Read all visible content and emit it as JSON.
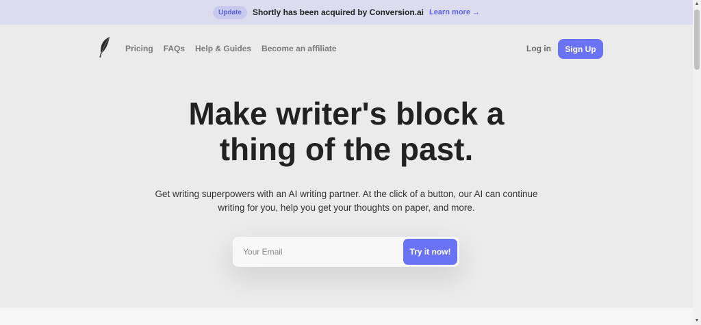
{
  "announcement": {
    "badge": "Update",
    "message": "Shortly has been acquired by Conversion.ai",
    "link_label": "Learn more",
    "link_arrow": "→"
  },
  "nav": {
    "logo_icon": "feather-icon",
    "links": [
      "Pricing",
      "FAQs",
      "Help & Guides",
      "Become an affiliate"
    ],
    "login_label": "Log in",
    "signup_label": "Sign Up"
  },
  "hero": {
    "title_line1": "Make writer's block a",
    "title_line2": "thing of the past.",
    "subtitle_line1": "Get writing superpowers with an AI writing partner. At the click of a button, our AI can continue",
    "subtitle_line2": "writing for you, help you get your thoughts on paper, and more."
  },
  "signup_form": {
    "email_placeholder": "Your Email",
    "email_value": "",
    "button_label": "Try it now!"
  },
  "scrollbar": {
    "up_arrow": "▲",
    "down_arrow": "▼"
  },
  "colors": {
    "accent": "#6b73f5",
    "announce_bg": "#dcdcef",
    "page_bg": "#ebebeb"
  }
}
